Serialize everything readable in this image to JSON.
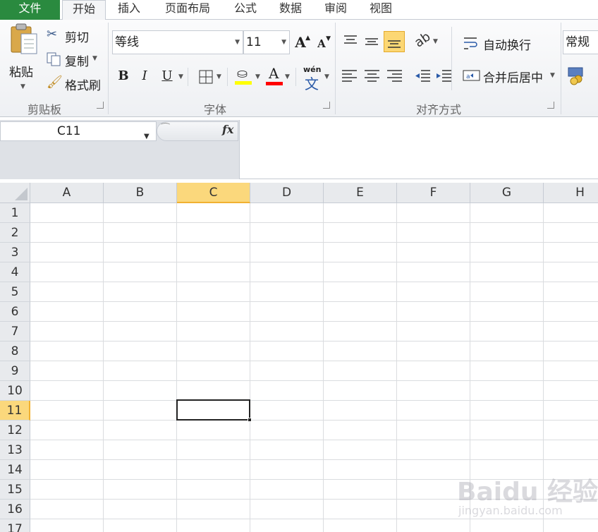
{
  "tabs": [
    "文件",
    "开始",
    "插入",
    "页面布局",
    "公式",
    "数据",
    "审阅",
    "视图"
  ],
  "clipboard": {
    "paste": "粘贴",
    "cut": "剪切",
    "copy": "复制",
    "format_painter": "格式刷",
    "group_label": "剪贴板"
  },
  "font": {
    "name": "等线",
    "size": "11",
    "bold": "B",
    "italic": "I",
    "underline": "U",
    "font_color_glyph": "A",
    "wen_glyph": "wén",
    "wen_char": "文",
    "grow": "A",
    "shrink": "A",
    "group_label": "字体",
    "fill_color": "#ffff00",
    "font_color": "#ff0000"
  },
  "alignment": {
    "wrap_text": "自动换行",
    "merge_center": "合并后居中",
    "group_label": "对齐方式"
  },
  "number": {
    "format": "常规"
  },
  "formula_bar": {
    "name_box": "C11",
    "fx": "fx",
    "value": ""
  },
  "sheet": {
    "columns": [
      "A",
      "B",
      "C",
      "D",
      "E",
      "F",
      "G",
      "H"
    ],
    "rows": [
      "1",
      "2",
      "3",
      "4",
      "5",
      "6",
      "7",
      "8",
      "9",
      "10",
      "11",
      "12",
      "13",
      "14",
      "15",
      "16",
      "17"
    ],
    "selected_column": "C",
    "selected_row": "11",
    "header_highlight": "#fbd87c"
  },
  "watermark": {
    "brand": "Baidu 经验",
    "url": "jingyan.baidu.com"
  }
}
